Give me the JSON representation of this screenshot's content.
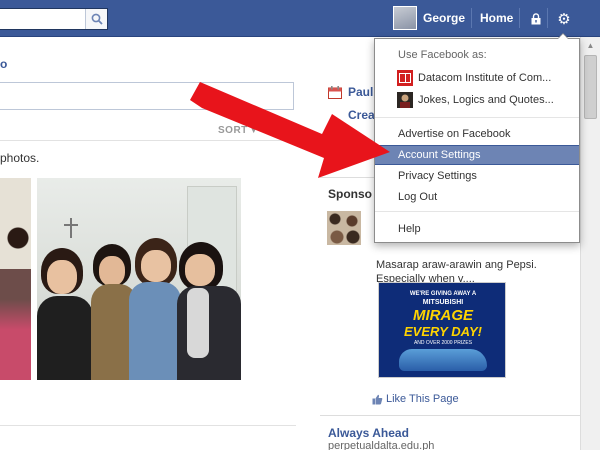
{
  "topbar": {
    "username": "George",
    "home_label": "Home",
    "icons": {
      "search": "search-icon",
      "lock": "lock-icon",
      "gear": "gear-icon"
    }
  },
  "left": {
    "link_partial": "o",
    "sort_label": "SORT",
    "photos_text": "photos."
  },
  "right": {
    "paul_partial": "Paul",
    "create_partial": "Crea",
    "sponsored_partial": "Sponso",
    "ad": {
      "text": "Masarap araw-arawin ang Pepsi. Especially when y....",
      "banner": {
        "line1": "WE'RE GIVING AWAY A",
        "line2": "MITSUBISHI",
        "line3": "MIRAGE",
        "line4": "EVERY DAY!",
        "line5": "AND OVER 2000 PRIZES"
      },
      "like_label": "Like This Page"
    },
    "ad2": {
      "title": "Always Ahead",
      "url": "perpetualdalta.edu.ph"
    }
  },
  "dropdown": {
    "header": "Use Facebook as:",
    "pages": [
      {
        "label": "Datacom Institute of Com..."
      },
      {
        "label": "Jokes, Logics and Quotes..."
      }
    ],
    "items": [
      {
        "label": "Advertise on Facebook",
        "active": false
      },
      {
        "label": "Account Settings",
        "active": true
      },
      {
        "label": "Privacy Settings",
        "active": false
      },
      {
        "label": "Log Out",
        "active": false
      },
      {
        "label": "Help",
        "active": false
      }
    ]
  },
  "colors": {
    "brand": "#3b5998",
    "highlight": "#6d84b4",
    "arrow": "#e8141b"
  }
}
